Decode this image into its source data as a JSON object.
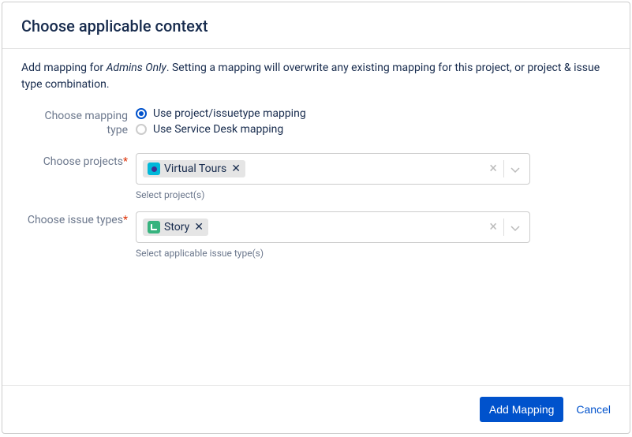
{
  "title": "Choose applicable context",
  "description_prefix": "Add mapping for ",
  "description_entity": "Admins Only",
  "description_suffix": ". Setting a mapping will overwrite any existing mapping for this project, or project & issue type combination.",
  "labels": {
    "mapping_type": "Choose mapping type",
    "projects": "Choose projects",
    "issue_types": "Choose issue types"
  },
  "radios": {
    "project_issuetype": "Use project/issuetype mapping",
    "service_desk": "Use Service Desk mapping"
  },
  "projects": {
    "chips": [
      {
        "label": "Virtual Tours"
      }
    ],
    "helper": "Select project(s)"
  },
  "issue_types": {
    "chips": [
      {
        "label": "Story"
      }
    ],
    "helper": "Select applicable issue type(s)"
  },
  "buttons": {
    "primary": "Add Mapping",
    "cancel": "Cancel"
  }
}
